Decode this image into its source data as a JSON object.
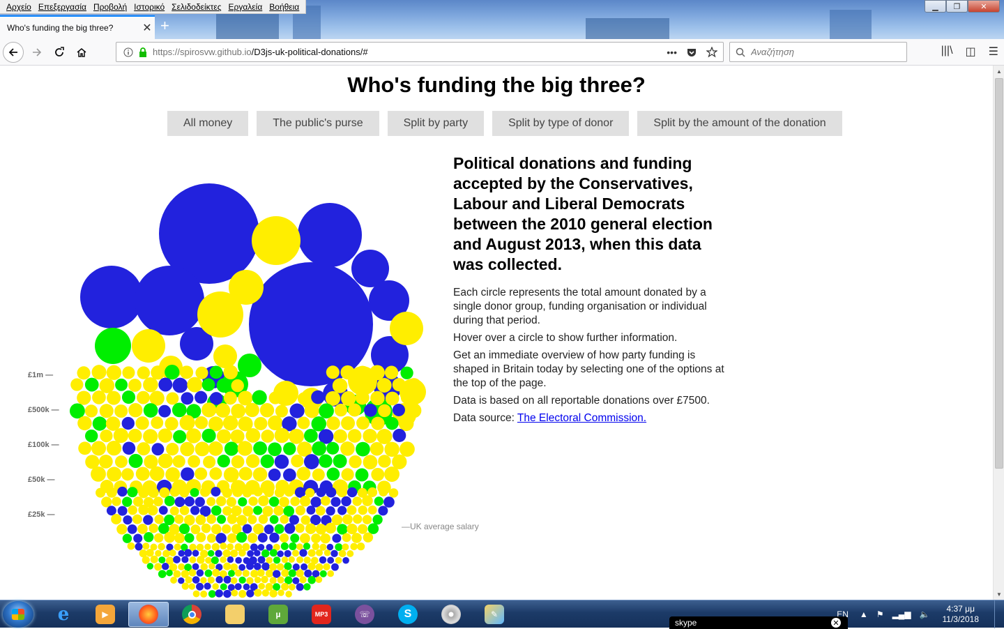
{
  "browser": {
    "menu": [
      "Αρχείο",
      "Επεξεργασία",
      "Προβολή",
      "Ιστορικό",
      "Σελιδοδείκτες",
      "Εργαλεία",
      "Βοήθεια"
    ],
    "tab_title": "Who's funding the big three?",
    "url_host": "https://spirosvw.github.io",
    "url_path": "/D3js-uk-political-donations/#",
    "search_placeholder": "Αναζήτηση"
  },
  "page": {
    "title": "Who's funding the big three?",
    "nav_buttons": [
      "All money",
      "The public's purse",
      "Split by party",
      "Split by type of donor",
      "Split by the amount of the donation"
    ],
    "headline": "Political donations and funding accepted by the Conservatives, Labour and Liberal Democrats between the 2010 general election and August 2013, when this data was collected.",
    "paragraphs": [
      "Each circle represents the total amount donated by a single donor group, funding organisation or individual during that period.",
      "Hover over a circle to show further information.",
      "Get an immediate overview of how party funding is shaped in Britain today by selecting one of the options at the top of the page.",
      "Data is based on all reportable donations over £7500."
    ],
    "source_prefix": "Data source: ",
    "source_link": "The Electoral Commission.",
    "axis_labels": [
      "£1m —",
      "£500k —",
      "£100k —",
      "£50k —",
      "£25k —"
    ],
    "salary_label": "—UK average salary"
  },
  "colors": {
    "conservative": "#2222dd",
    "labour": "#ffee00",
    "libdem": "#00ee00"
  },
  "taskbar": {
    "lang": "EN",
    "time": "4:37 μμ",
    "date": "11/3/2018",
    "skype": "skype"
  }
}
